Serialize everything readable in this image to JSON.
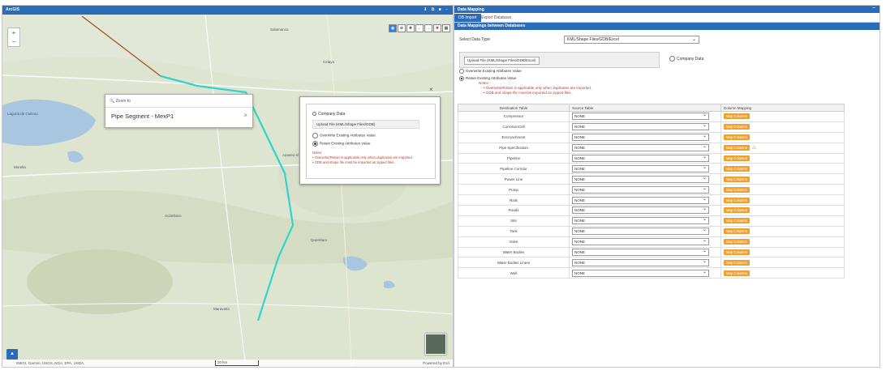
{
  "map": {
    "title": "ArcGIS",
    "zoom_in": "+",
    "zoom_out": "−",
    "popup": {
      "zoom_to": "Zoom to",
      "feature_title": "Pipe Segment - MexP1",
      "close": "×"
    },
    "float_panel": {
      "close": "×",
      "company_data": "Company Data",
      "upload_label": "Upload File (KML/Shape Files/GDB)",
      "overwrite": "Overwrite Existing Attributes Value",
      "retain": "Retain Existing Attributes Value",
      "notes_label": "Notes:",
      "notes": [
        "Overwrite/Retain is applicable only when duplicates are imported.",
        "GDB and shape file must be imported as zipped files."
      ]
    },
    "footer": {
      "attribution": "INEGI, Garmin, USGS, NGA, EPA, USDA,",
      "scale": "20 km",
      "powered": "Powered by Esri"
    },
    "place_labels": [
      "Laguna de Cuitzeo",
      "Morelia",
      "Salamanca",
      "Celaya",
      "Querétaro",
      "Acámbaro",
      "Maravatío",
      "Apaseo el Grande"
    ]
  },
  "data_mapping": {
    "panel_title": "Data Mapping",
    "tabs": [
      "DB Import",
      "Export Database"
    ],
    "section_title": "Data Mappings between Databases",
    "select_type_label": "Select Data Type",
    "select_type_value": "KML/Shape Files/GDB/Excel",
    "upload_label": "Upload File (KML/Shape Files/GDB/Excel)",
    "company_data": "Company Data",
    "overwrite": "Overwrite Existing Attributes Value",
    "retain": "Retain Existing Attributes Value",
    "notes_label": "Notes:",
    "notes": [
      "Overwrite/Retain is applicable only when duplicates are imported.",
      "GDB and shape file must be imported as zipped files."
    ],
    "table": {
      "headers": [
        "Destination Table",
        "Source Table",
        "Column Mapping"
      ],
      "source_default": "NONE",
      "button_label": "Map Columns",
      "rows": [
        {
          "dest": "Compressor",
          "warn": false
        },
        {
          "dest": "CorrosionCell",
          "warn": false
        },
        {
          "dest": "Encroachment",
          "warn": false
        },
        {
          "dest": "Pipe Specification",
          "warn": true
        },
        {
          "dest": "Pipeline",
          "warn": false
        },
        {
          "dest": "Pipeline Corridor",
          "warn": false
        },
        {
          "dest": "Power Line",
          "warn": false
        },
        {
          "dest": "Pump",
          "warn": false
        },
        {
          "dest": "Rails",
          "warn": false
        },
        {
          "dest": "Roads",
          "warn": false
        },
        {
          "dest": "Site",
          "warn": false
        },
        {
          "dest": "Tank",
          "warn": false
        },
        {
          "dest": "Valve",
          "warn": false
        },
        {
          "dest": "Water Bodies",
          "warn": false
        },
        {
          "dest": "Water Bodies Linear",
          "warn": false
        },
        {
          "dest": "Well",
          "warn": false
        }
      ]
    }
  },
  "colors": {
    "header_blue": "#2b6cb8",
    "button_orange": "#f0a030",
    "note_red": "#c0392b",
    "pipeline_cyan": "#2fd6c8",
    "pipeline_brown": "#a0522d"
  }
}
